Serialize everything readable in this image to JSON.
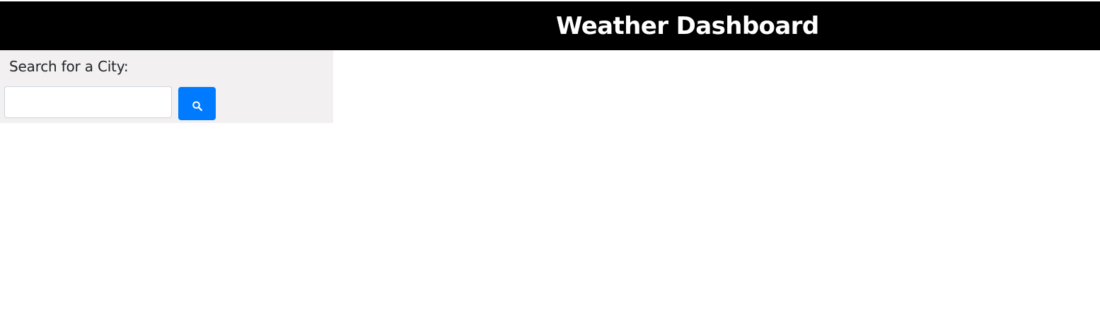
{
  "header": {
    "title": "Weather Dashboard"
  },
  "sidebar": {
    "search_label": "Search for a City:",
    "search_input_value": "",
    "search_button_icon": "search-icon"
  },
  "colors": {
    "header_background": "#000000",
    "header_text": "#ffffff",
    "sidebar_background": "#f2f0f0",
    "button_primary": "#007bff"
  }
}
